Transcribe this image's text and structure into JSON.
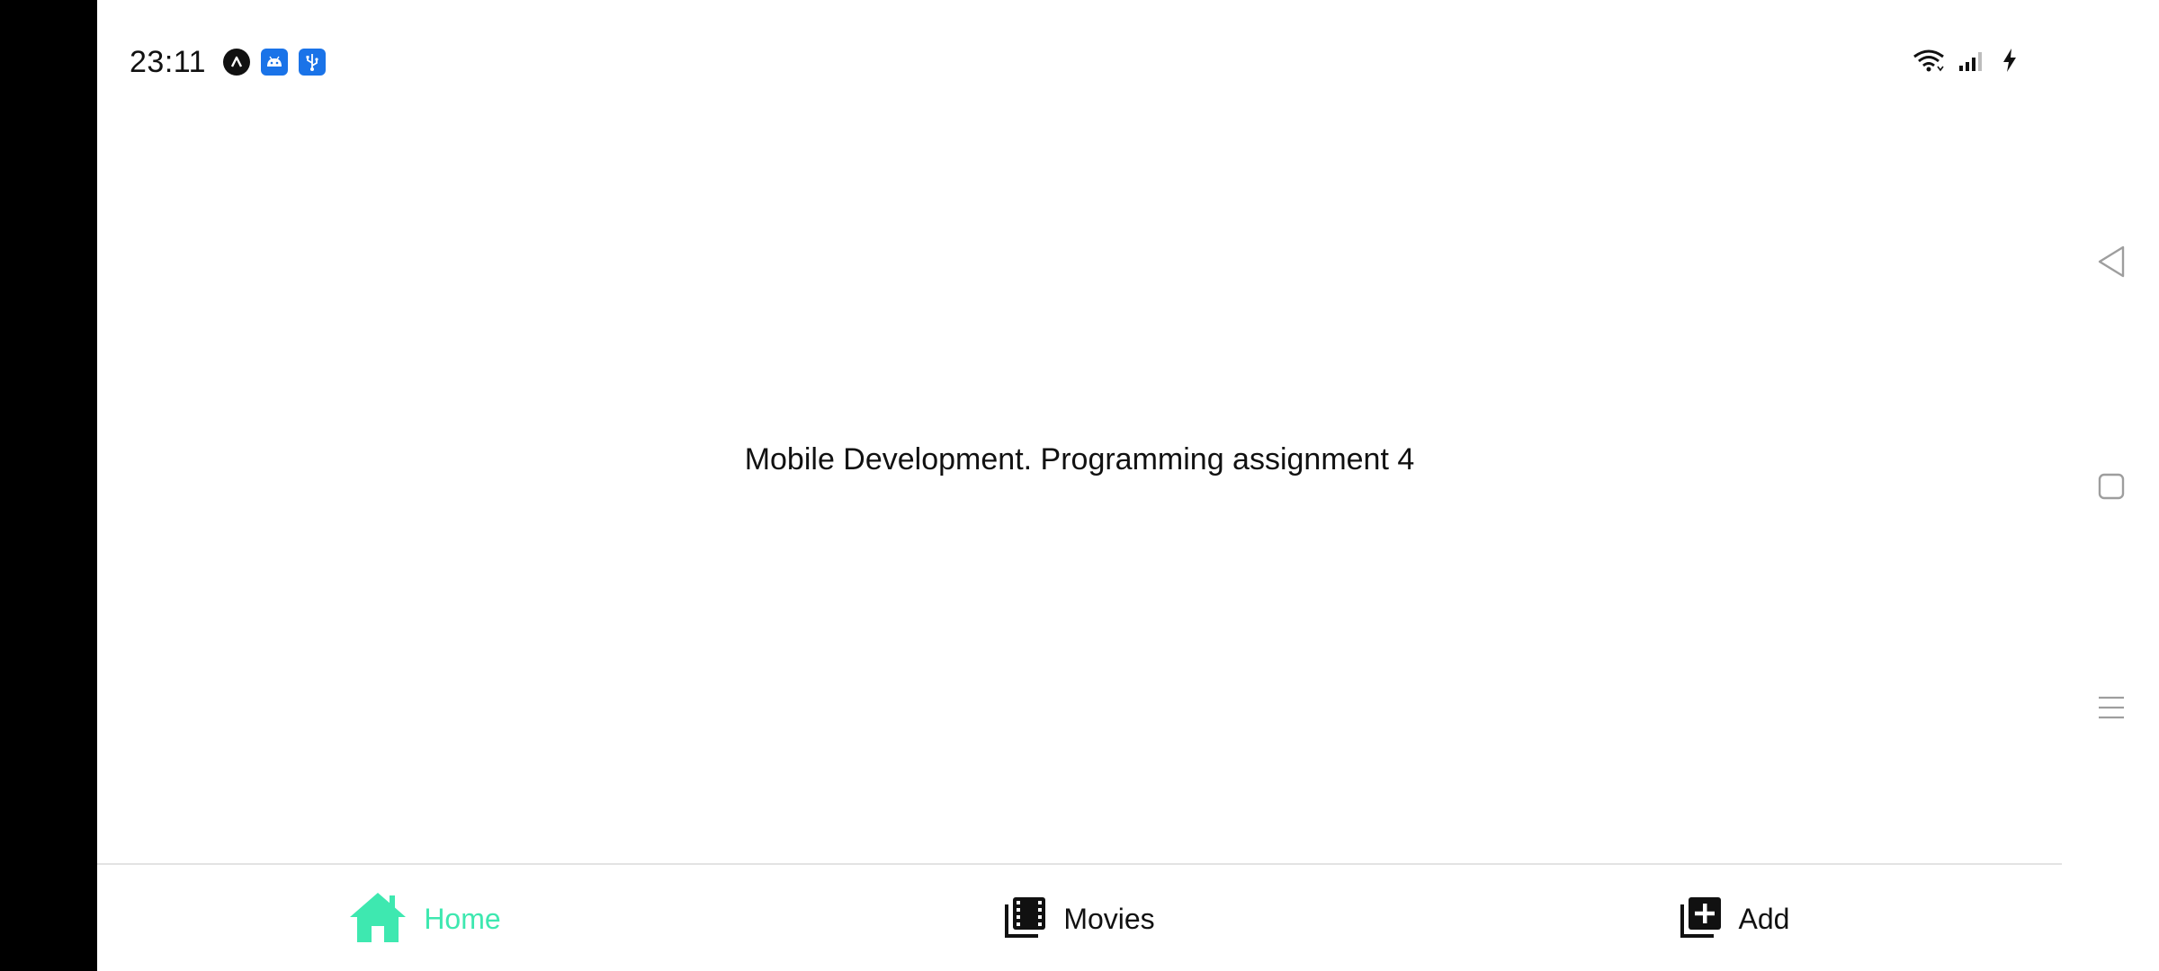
{
  "status_bar": {
    "time": "23:11",
    "notification_icons": [
      "app-notification-icon",
      "android-icon",
      "usb-icon"
    ],
    "system_icons": [
      "wifi-icon",
      "signal-icon",
      "charging-icon"
    ]
  },
  "main": {
    "text": "Mobile Development. Programming assignment 4"
  },
  "tab_bar": {
    "active_color": "#3ee8b0",
    "tabs": [
      {
        "label": "Home",
        "icon": "home-icon",
        "active": true
      },
      {
        "label": "Movies",
        "icon": "movies-icon",
        "active": false
      },
      {
        "label": "Add",
        "icon": "add-icon",
        "active": false
      }
    ]
  },
  "nav_keys": [
    "back-icon",
    "home-square-icon",
    "menu-icon"
  ]
}
